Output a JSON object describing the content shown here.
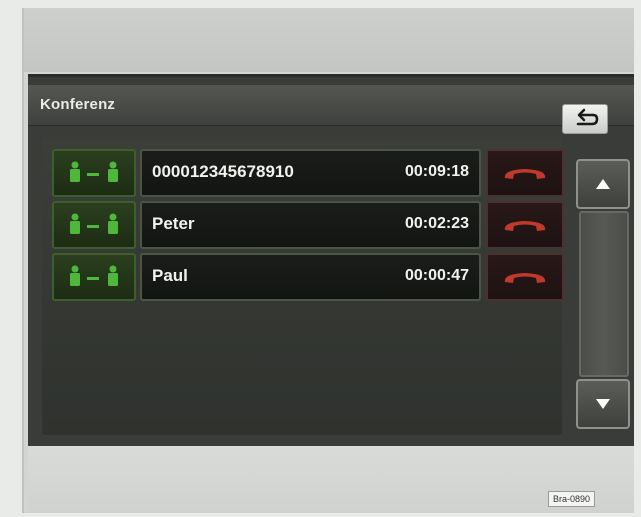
{
  "screen": {
    "title": "Konferenz",
    "back_icon": "back-arrow-icon"
  },
  "calls": [
    {
      "name": "000012345678910",
      "duration": "00:09:18"
    },
    {
      "name": "Peter",
      "duration": "00:02:23"
    },
    {
      "name": "Paul",
      "duration": "00:00:47"
    }
  ],
  "icons": {
    "conference": "conference-people-icon",
    "hangup": "hangup-phone-icon",
    "scroll_up": "scroll-up-arrow-icon",
    "scroll_down": "scroll-down-arrow-icon"
  },
  "colors": {
    "conference_green": "#4fb83c",
    "hangup_red": "#c0392b"
  },
  "footer": {
    "image_ref": "Bra-0890"
  }
}
